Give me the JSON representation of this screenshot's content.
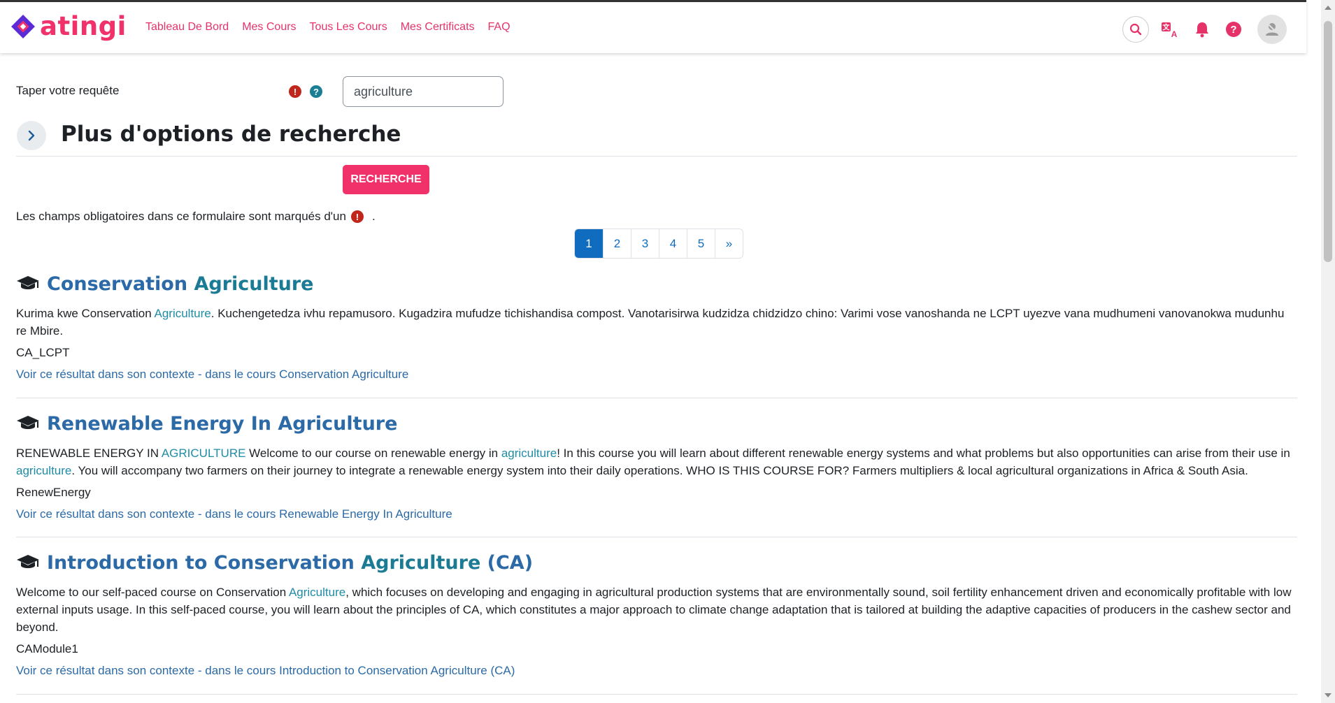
{
  "brand": {
    "name": "atingi",
    "color": "#f0316a"
  },
  "nav": [
    "Tableau De Bord",
    "Mes Cours",
    "Tous Les Cours",
    "Mes Certificats",
    "FAQ"
  ],
  "icons": [
    "search-icon",
    "translate-icon",
    "bell-icon",
    "help-icon",
    "user-avatar"
  ],
  "form": {
    "query_label": "Taper votre requête",
    "query_value": "agriculture",
    "more_options": "Plus d'options de recherche",
    "search_button": "RECHERCHE",
    "required_note": "Les champs obligatoires dans ce formulaire sont marqués d'un",
    "required_note_end": "."
  },
  "pagination": {
    "pages": [
      "1",
      "2",
      "3",
      "4",
      "5"
    ],
    "next": "»",
    "current": "1"
  },
  "results": [
    {
      "title_pre": "Conservation ",
      "title_hl": "Agriculture",
      "title_post": "",
      "desc_parts": [
        {
          "t": "Kurima kwe Conservation ",
          "hl": false
        },
        {
          "t": "Agriculture",
          "hl": true
        },
        {
          "t": ". Kuchengetedza ivhu repamusoro. Kugadzira mufudze tichishandisa compost. Vanotarisirwa kudzidza chidzidzo chino: Varimi vose vanoshanda ne LCPT uyezve vana mudhumeni vanovanokwa mudunhu re Mbire.",
          "hl": false
        }
      ],
      "code": "CA_LCPT",
      "link": "Voir ce résultat dans son contexte - dans le cours Conservation Agriculture"
    },
    {
      "title_pre": "Renewable Energy In Agriculture",
      "title_hl": "",
      "title_post": "",
      "desc_parts": [
        {
          "t": "RENEWABLE ENERGY IN ",
          "hl": false
        },
        {
          "t": "AGRICULTURE",
          "hl": true
        },
        {
          "t": " Welcome to our course on renewable energy in ",
          "hl": false
        },
        {
          "t": "agriculture",
          "hl": true
        },
        {
          "t": "! In this course you will learn about different renewable energy systems and what problems but also opportunities can arise from their use in ",
          "hl": false
        },
        {
          "t": "agriculture",
          "hl": true
        },
        {
          "t": ". You will accompany two farmers on their journey to integrate a renewable energy system into their daily operations. WHO IS THIS COURSE FOR? Farmers multipliers & local agricultural organizations in Africa & South Asia.",
          "hl": false
        }
      ],
      "code": "RenewEnergy",
      "link": "Voir ce résultat dans son contexte - dans le cours Renewable Energy In Agriculture"
    },
    {
      "title_pre": "Introduction to Conservation ",
      "title_hl": "Agriculture",
      "title_post": " (CA)",
      "desc_parts": [
        {
          "t": "Welcome to our self-paced course on Conservation ",
          "hl": false
        },
        {
          "t": "Agriculture",
          "hl": true
        },
        {
          "t": ", which focuses on developing and engaging in agricultural production systems that are environmentally sound, soil fertility enhancement driven and economically profitable with low external inputs usage. In this self-paced course, you will learn about the principles of CA, which constitutes a major approach to climate change adaptation that is tailored at building the adaptive capacities of producers in the cashew sector and beyond.",
          "hl": false
        }
      ],
      "code": "CAModule1",
      "link": "Voir ce résultat dans son contexte - dans le cours Introduction to Conservation Agriculture (CA)"
    }
  ]
}
